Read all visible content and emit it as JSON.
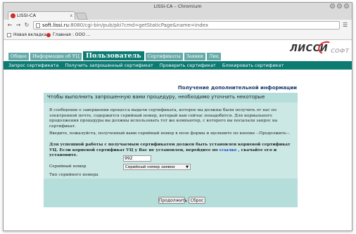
{
  "window": {
    "title": "LISSI-CA – Chromium"
  },
  "tab": {
    "title": "LISSI-CA",
    "close": "x"
  },
  "address": {
    "host": "soft.lissi.ru",
    "rest": ":8080/cgi-bin/pub/pki?cmd=getStaticPage&name=index"
  },
  "bookmarks": {
    "items": [
      "Новая вкладка",
      "Главная : ООО ..."
    ]
  },
  "site": {
    "tabs": [
      "Общее",
      "Информация об УЦ",
      "Пользователь",
      "Сертификаты",
      "Заявки",
      "Лиц"
    ],
    "active_tab": "Пользователь",
    "logo_main": "ЛИССИ",
    "logo_sub": "СОФТ",
    "subnav": [
      "Запрос сертификата",
      "Получить запрошенный сертификат",
      "Проверить сертификат",
      "Блокировать сертификат"
    ]
  },
  "page": {
    "heading": "Получение дополнительной информации",
    "panel_head": "Чтобы выполнить запрошенную вами процедуру, необходимо уточнить некоторые дополнительные детали.",
    "para1": "В сообщении о завершении процесса выдачи сертификата, которое вы должны были получить от нас по электронной почте, содержится серийный номер, который вам сейчас понадобится. Для нормального продолжения процедуры вы должны использовать тот же компьютер, с которого вы посылали запрос на сертификат.",
    "para2": "Введите, пожалуйста, полученный вами серийный номер в поле формы и щелкните по кнопке --Продолжить--.",
    "para3_a": "Для успешной работы с получаемым сертификатом должен быть установлен корневой сертификат УЦ. Если корневой сертификат УЦ у Вас не установлен, перейдите по",
    "para3_link": "ссылке",
    "para3_b": ", скачайте его и установите.",
    "serial_label": "Серийный номер",
    "serial_value": "992",
    "type_label": "Тип серийного номера",
    "type_value": "Серийный номер заявки",
    "continue": "Продолжить",
    "reset": "Сброс"
  },
  "colors": {
    "teal": "#0e7b73",
    "panel": "#b5dedb",
    "panel_body": "#cbe8e5",
    "accent_red": "#d8262f"
  }
}
